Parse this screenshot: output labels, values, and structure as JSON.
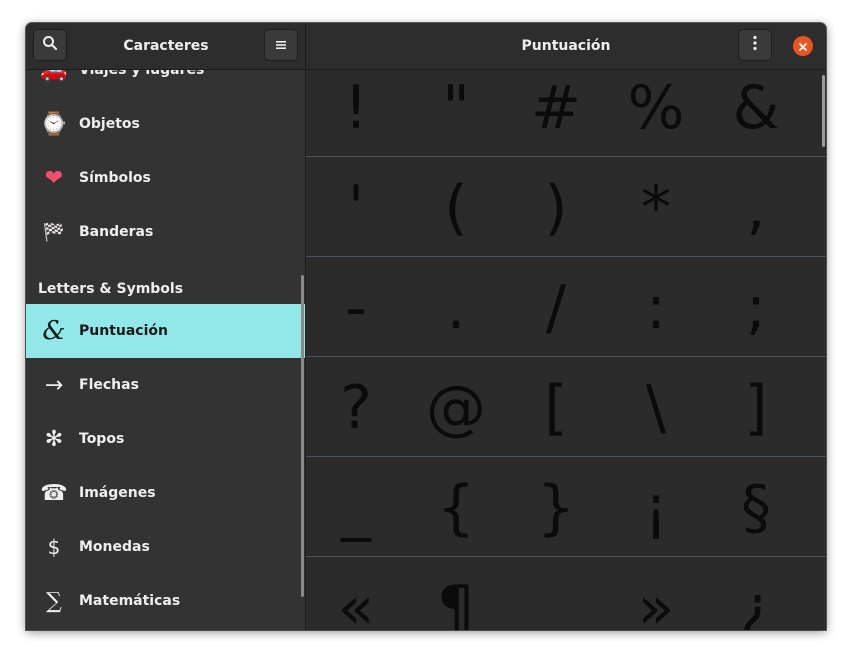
{
  "window": {
    "sidebar_title": "Caracteres",
    "main_title": "Puntuación"
  },
  "header": {
    "search_icon": "search-icon",
    "menu_icon": "hamburger-icon",
    "more_icon": "vertical-dots-icon",
    "close_icon": "close-icon",
    "close_color": "#e95420"
  },
  "sidebar": {
    "items": [
      {
        "label": "Viajes y lugares",
        "icon": "car-icon",
        "glyph": "🚗"
      },
      {
        "label": "Objetos",
        "icon": "watch-icon",
        "glyph": "⌚"
      },
      {
        "label": "Símbolos",
        "icon": "heart-icon",
        "glyph": "❤"
      },
      {
        "label": "Banderas",
        "icon": "checkered-flag-icon",
        "glyph": "🏁"
      }
    ],
    "section_header": "Letters & Symbols",
    "letters": [
      {
        "label": "Puntuación",
        "icon": "ampersand-icon",
        "glyph": "&",
        "selected": true
      },
      {
        "label": "Flechas",
        "icon": "arrow-right-icon",
        "glyph": "→"
      },
      {
        "label": "Topos",
        "icon": "flower-icon",
        "glyph": "✻"
      },
      {
        "label": "Imágenes",
        "icon": "telephone-icon",
        "glyph": "☎"
      },
      {
        "label": "Monedas",
        "icon": "dollar-icon",
        "glyph": "$"
      },
      {
        "label": "Matemáticas",
        "icon": "sigma-icon",
        "glyph": "∑"
      }
    ],
    "selected_color": "#92e8e9"
  },
  "grid": {
    "rows": [
      [
        "!",
        "\"",
        "#",
        "%",
        "&"
      ],
      [
        "'",
        "(",
        ")",
        "*",
        ","
      ],
      [
        "-",
        ".",
        "/",
        ":",
        ";"
      ],
      [
        "?",
        "@",
        "[",
        "\\",
        "]"
      ],
      [
        "_",
        "{",
        "}",
        "¡",
        "§"
      ],
      [
        "«",
        "¶",
        "",
        "»",
        "¿"
      ]
    ]
  }
}
